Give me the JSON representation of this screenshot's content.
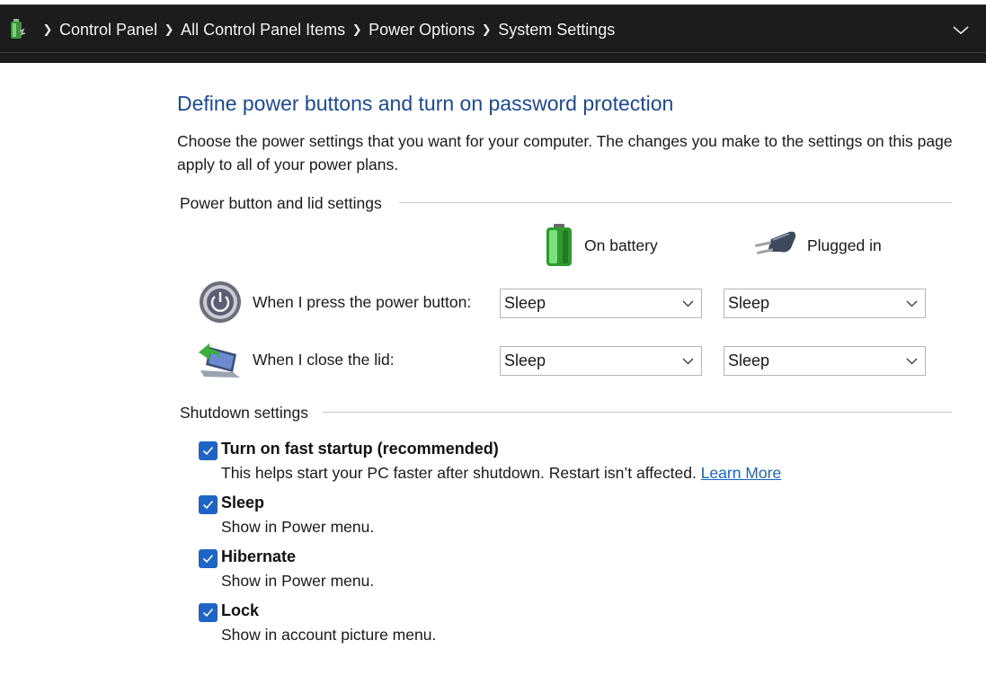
{
  "breadcrumb": {
    "items": [
      "Control Panel",
      "All Control Panel Items",
      "Power Options",
      "System Settings"
    ],
    "separator": ">"
  },
  "page": {
    "title": "Define power buttons and turn on password protection",
    "description": "Choose the power settings that you want for your computer. The changes you make to the settings on this page apply to all of your power plans."
  },
  "power_section": {
    "header": "Power button and lid settings",
    "columns": {
      "battery": {
        "label": "On battery",
        "icon": "battery-icon"
      },
      "plugged": {
        "label": "Plugged in",
        "icon": "power-plug-icon"
      }
    },
    "rows": [
      {
        "label": "When I press the power button:",
        "icon": "power-button-icon",
        "battery": "Sleep",
        "plugged": "Sleep"
      },
      {
        "label": "When I close the lid:",
        "icon": "laptop-lid-icon",
        "battery": "Sleep",
        "plugged": "Sleep"
      }
    ]
  },
  "shutdown_section": {
    "header": "Shutdown settings",
    "options": [
      {
        "title": "Turn on fast startup (recommended)",
        "description": "This helps start your PC faster after shutdown. Restart isn’t affected.",
        "link": "Learn More",
        "checked": true
      },
      {
        "title": "Sleep",
        "description": "Show in Power menu.",
        "checked": true
      },
      {
        "title": "Hibernate",
        "description": "Show in Power menu.",
        "checked": true
      },
      {
        "title": "Lock",
        "description": "Show in account picture menu.",
        "checked": true
      }
    ]
  },
  "colors": {
    "title_blue": "#1b4a93",
    "link_blue": "#1766c1",
    "checkbox_blue": "#1e63c6",
    "addressbar_bg": "#1c1c1c"
  }
}
